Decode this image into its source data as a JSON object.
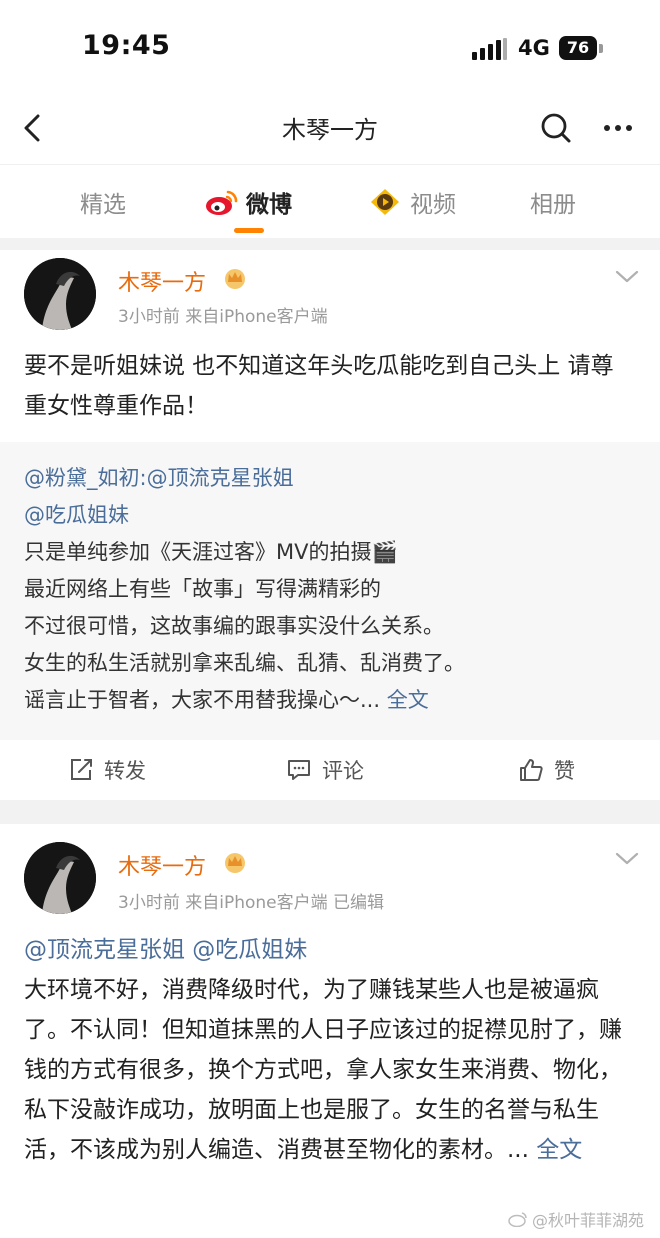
{
  "status_bar": {
    "time": "19:45",
    "network": "4G",
    "battery": "76"
  },
  "nav": {
    "title": "木琴一方"
  },
  "tabs": [
    {
      "label": "精选",
      "active": false
    },
    {
      "label": "微博",
      "active": true
    },
    {
      "label": "视频",
      "active": false
    },
    {
      "label": "相册",
      "active": false
    }
  ],
  "accent_color": "#ff8200",
  "posts": [
    {
      "author": "木琴一方",
      "meta": "3小时前  来自iPhone客户端",
      "text": "要不是听姐妹说 也不知道这年头吃瓜能吃到自己头上 请尊重女性尊重作品！",
      "repost": {
        "line1": "@粉黛_如初:@顶流克星张姐",
        "line2": "@吃瓜姐妹",
        "line3": "只是单纯参加《天涯过客》MV的拍摄🎬",
        "line4": "最近网络上有些「故事」写得满精彩的",
        "line5": "不过很可惜，这故事编的跟事实没什么关系。",
        "line6": "女生的私生活就别拿来乱编、乱猜、乱消费了。",
        "line7": "谣言止于智者，大家不用替我操心～...",
        "full_text_link": "全文"
      },
      "actions": {
        "repost": "转发",
        "comment": "评论",
        "like": "赞"
      }
    },
    {
      "author": "木琴一方",
      "meta": "3小时前  来自iPhone客户端  已编辑",
      "mentions": "@顶流克星张姐 @吃瓜姐妹",
      "text": "大环境不好，消费降级时代，为了赚钱某些人也是被逼疯了。不认同！但知道抹黑的人日子应该过的捉襟见肘了，赚钱的方式有很多，换个方式吧，拿人家女生来消费、物化，私下没敲诈成功，放明面上也是服了。女生的名誉与私生活，不该成为别人编造、消费甚至物化的素材。...",
      "full_text_link": "全文"
    }
  ],
  "watermark": "@秋叶菲菲湖苑"
}
